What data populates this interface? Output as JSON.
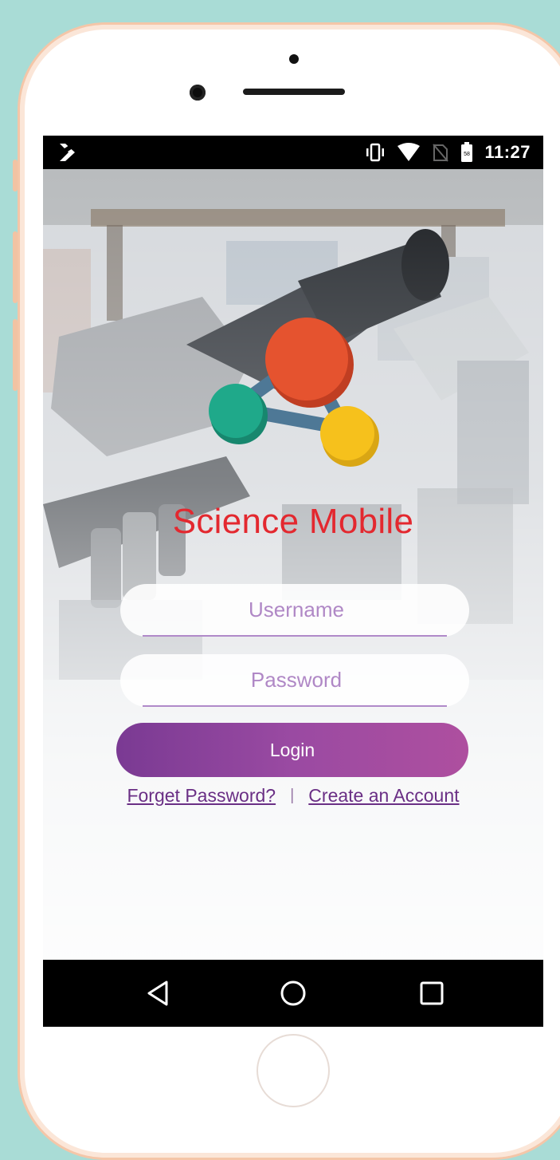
{
  "status_bar": {
    "time": "11:27",
    "battery_level": "58",
    "icons": [
      "notification-app-icon",
      "vibrate-icon",
      "wifi-icon",
      "no-sim-icon",
      "battery-icon"
    ]
  },
  "app": {
    "title": "Science Mobile",
    "title_color": "#e3282f",
    "logo_colors": {
      "red": "#e5532f",
      "green": "#1fa98a",
      "yellow": "#f6c11c",
      "connector": "#4e7896"
    }
  },
  "login_form": {
    "username_placeholder": "Username",
    "password_placeholder": "Password",
    "login_label": "Login",
    "forgot_link": "Forget Password?",
    "separator": "|",
    "create_account_link": "Create an Account"
  },
  "nav_bar": {
    "buttons": [
      "back-icon",
      "home-icon",
      "recents-icon"
    ]
  },
  "theme": {
    "accent": "#8a3f9c",
    "background": "#a9dcd6"
  }
}
